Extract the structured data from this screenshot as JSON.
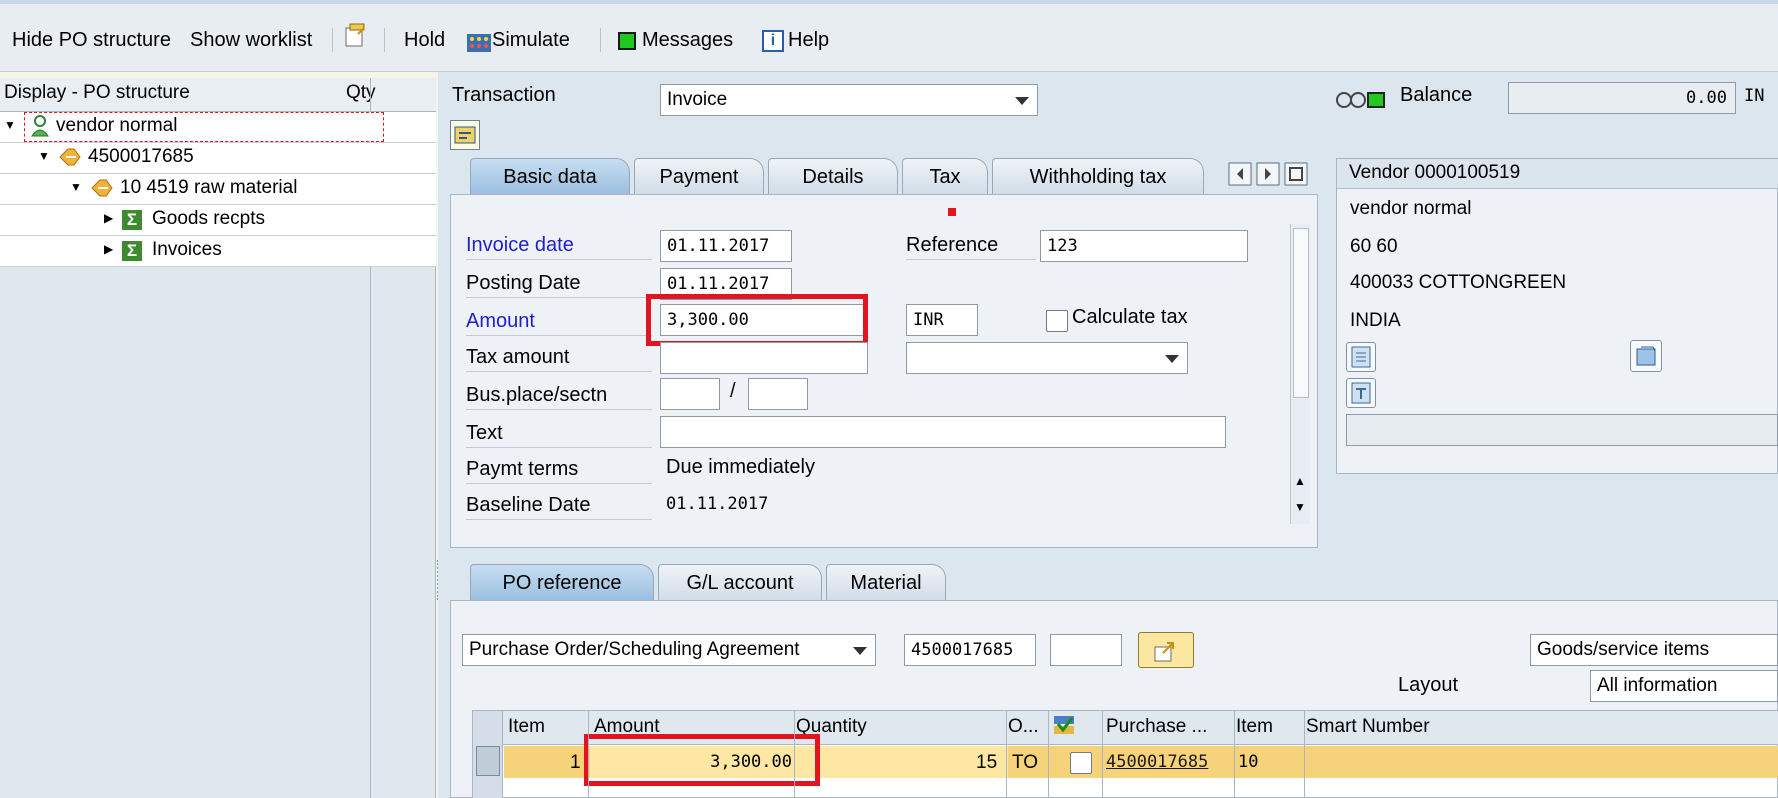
{
  "toolbar": {
    "hide_po": "Hide PO structure",
    "show_worklist": "Show worklist",
    "hold": "Hold",
    "simulate": "Simulate",
    "messages": "Messages",
    "help": "Help"
  },
  "tree": {
    "header_label": "Display - PO structure",
    "header_qty": "Qty",
    "nodes": [
      {
        "label": "vendor normal",
        "icon": "person-icon"
      },
      {
        "label": "4500017685",
        "icon": "po-icon"
      },
      {
        "label": "10 4519 raw material",
        "icon": "po-item-icon"
      },
      {
        "label": "Goods recpts",
        "icon": "sum-icon"
      },
      {
        "label": "Invoices",
        "icon": "sum-icon"
      }
    ]
  },
  "header": {
    "transaction_label": "Transaction",
    "transaction_value": "Invoice",
    "balance_label": "Balance",
    "balance_value": "0.00",
    "balance_currency": "IN"
  },
  "tabs_top": [
    "Basic data",
    "Payment",
    "Details",
    "Tax",
    "Withholding tax"
  ],
  "basic": {
    "invoice_date_label": "Invoice date",
    "invoice_date": "01.11.2017",
    "reference_label": "Reference",
    "reference": "123",
    "posting_date_label": "Posting Date",
    "posting_date": "01.11.2017",
    "amount_label": "Amount",
    "amount": "3,300.00",
    "currency": "INR",
    "calc_tax_label": "Calculate tax",
    "tax_amount_label": "Tax amount",
    "bus_place_label": "Bus.place/sectn",
    "slash": "/",
    "text_label": "Text",
    "paymt_terms_label": "Paymt terms",
    "paymt_terms": "Due immediately",
    "baseline_label": "Baseline Date",
    "baseline_date": "01.11.2017"
  },
  "vendor": {
    "title": "Vendor 0000100519",
    "name": "vendor normal",
    "street": "60 60",
    "city": "400033 COTTONGREEN",
    "country": "INDIA"
  },
  "tabs_bottom": [
    "PO reference",
    "G/L account",
    "Material"
  ],
  "po_ref": {
    "doc_type": "Purchase Order/Scheduling Agreement",
    "po_number": "4500017685",
    "goods_select": "Goods/service items",
    "layout_label": "Layout",
    "layout_value": "All information"
  },
  "table": {
    "columns": [
      "Item",
      "Amount",
      "Quantity",
      "O...",
      "Purchase ...",
      "Item",
      "Smart Number"
    ],
    "row": {
      "item": "1",
      "amount": "3,300.00",
      "quantity": "15",
      "unit": "TO",
      "po": "4500017685",
      "po_item": "10"
    }
  },
  "colors": {
    "highlight_red": "#e1141f",
    "row_yellow": "#f6d27a",
    "row_light": "#fde7a3"
  }
}
